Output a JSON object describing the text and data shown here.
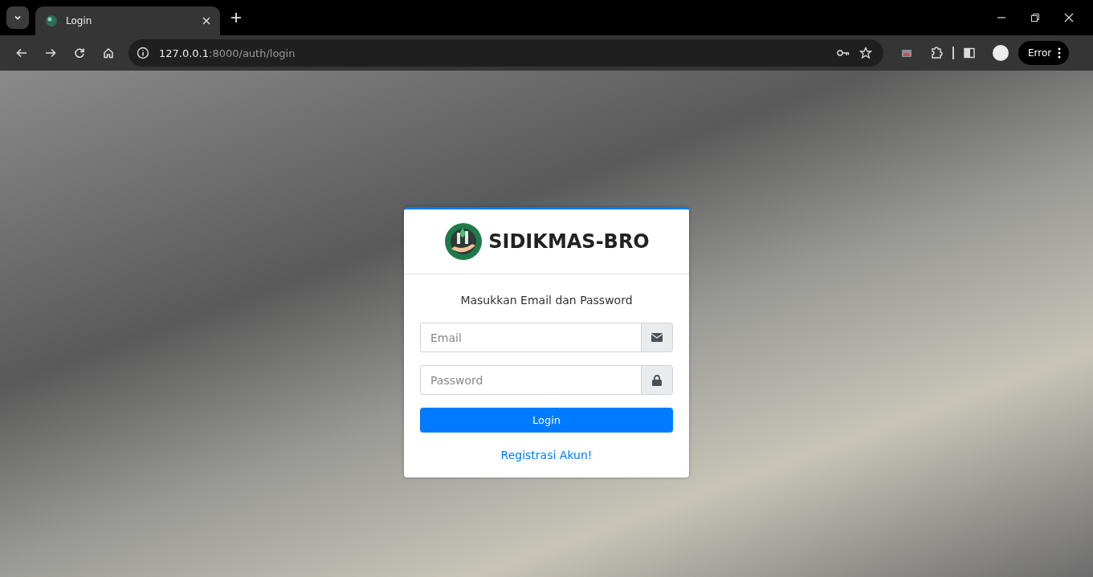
{
  "browser": {
    "tabs": [
      {
        "title": "Login",
        "selected": true
      }
    ],
    "address": {
      "host": "127.0.0.1",
      "path": ":8000/auth/login"
    },
    "profile_button": "Error"
  },
  "login": {
    "brand": "SIDIKMAS-BRO",
    "subtitle": "Masukkan Email dan Password",
    "fields": [
      {
        "kind": "email",
        "placeholder": "Email"
      },
      {
        "kind": "password",
        "placeholder": "Password"
      }
    ],
    "submit": "Login",
    "register_link": "Registrasi Akun!"
  }
}
